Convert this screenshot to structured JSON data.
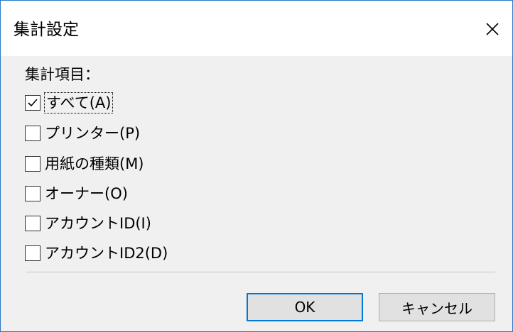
{
  "window": {
    "title": "集計設定",
    "close_glyph": "×"
  },
  "group": {
    "label": "集計項目："
  },
  "checkboxes": [
    {
      "label": "すべて(A)",
      "checked": true
    },
    {
      "label": "プリンター(P)",
      "checked": false
    },
    {
      "label": "用紙の種類(M)",
      "checked": false
    },
    {
      "label": "オーナー(O)",
      "checked": false
    },
    {
      "label": "アカウントID(I)",
      "checked": false
    },
    {
      "label": "アカウントID2(D)",
      "checked": false
    }
  ],
  "buttons": {
    "ok_label": "OK",
    "cancel_label": "キャンセル"
  },
  "colors": {
    "accent": "#0078d7",
    "window_border": "#2b78c8",
    "client_bg": "#f0f0f0"
  }
}
